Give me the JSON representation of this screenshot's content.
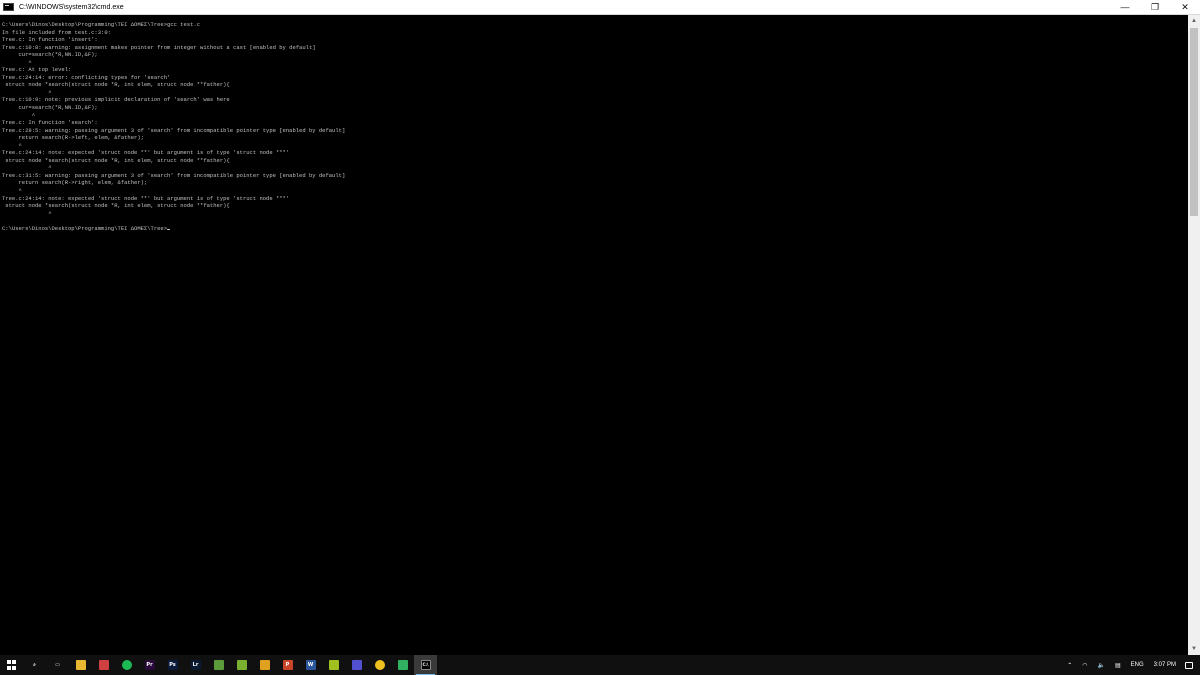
{
  "window": {
    "title": "C:\\WINDOWS\\system32\\cmd.exe",
    "minimize_glyph": "—",
    "restore_glyph": "❐",
    "close_glyph": "✕"
  },
  "console": {
    "lines": [
      "C:\\Users\\Dinos\\Desktop\\Programming\\TEI ΔOMEΣ\\Tree>gcc test.c",
      "In file included from test.c:3:0:",
      "Tree.c: In function 'insert':",
      "Tree.c:10:8: warning: assignment makes pointer from integer without a cast [enabled by default]",
      "     cur=search(*R,NN.ID,&F);",
      "        ^",
      "Tree.c: At top level:",
      "Tree.c:24:14: error: conflicting types for 'search'",
      " struct node *search(struct node *R, int elem, struct node **father){",
      "              ^",
      "Tree.c:10:9: note: previous implicit declaration of 'search' was here",
      "     cur=search(*R,NN.ID,&F);",
      "         ^",
      "Tree.c: In function 'search':",
      "Tree.c:29:5: warning: passing argument 3 of 'search' from incompatible pointer type [enabled by default]",
      "     return search(R->left, elem, &father);",
      "     ^",
      "Tree.c:24:14: note: expected 'struct node **' but argument is of type 'struct node ***'",
      " struct node *search(struct node *R, int elem, struct node **father){",
      "              ^",
      "Tree.c:31:5: warning: passing argument 3 of 'search' from incompatible pointer type [enabled by default]",
      "     return search(R->right, elem, &father);",
      "     ^",
      "Tree.c:24:14: note: expected 'struct node **' but argument is of type 'struct node ***'",
      " struct node *search(struct node *R, int elem, struct node **father){",
      "              ^",
      "",
      "C:\\Users\\Dinos\\Desktop\\Programming\\TEI ΔOMEΣ\\Tree>"
    ]
  },
  "taskbar": {
    "apps": [
      {
        "name": "search-icon",
        "label": "⌕",
        "color": "#101010"
      },
      {
        "name": "task-view-icon",
        "label": "▭",
        "color": "#101010"
      },
      {
        "name": "file-explorer-icon",
        "label": "",
        "color": "#e8b830"
      },
      {
        "name": "app-icon",
        "label": "",
        "color": "#d04040"
      },
      {
        "name": "spotify-icon",
        "label": "",
        "color": "#1db954"
      },
      {
        "name": "premiere-icon",
        "label": "Pr",
        "color": "#2a0a3a"
      },
      {
        "name": "photoshop-icon",
        "label": "Ps",
        "color": "#0a1a3a"
      },
      {
        "name": "lightroom-icon",
        "label": "Lr",
        "color": "#0a1a30"
      },
      {
        "name": "app-icon",
        "label": "",
        "color": "#5a9a3a"
      },
      {
        "name": "app-icon",
        "label": "",
        "color": "#7ab030"
      },
      {
        "name": "app-icon",
        "label": "",
        "color": "#e0a020"
      },
      {
        "name": "powerpoint-icon",
        "label": "P",
        "color": "#c8452a"
      },
      {
        "name": "word-icon",
        "label": "W",
        "color": "#2b579a"
      },
      {
        "name": "app-icon",
        "label": "",
        "color": "#a0c020"
      },
      {
        "name": "app-icon",
        "label": "",
        "color": "#5050d0"
      },
      {
        "name": "chrome-icon",
        "label": "",
        "color": "#f0c020"
      },
      {
        "name": "app-icon",
        "label": "",
        "color": "#30b060"
      },
      {
        "name": "cmd-icon",
        "label": "C:\\",
        "color": "#000000"
      }
    ],
    "language": "ENG",
    "time": "3:07 PM"
  }
}
